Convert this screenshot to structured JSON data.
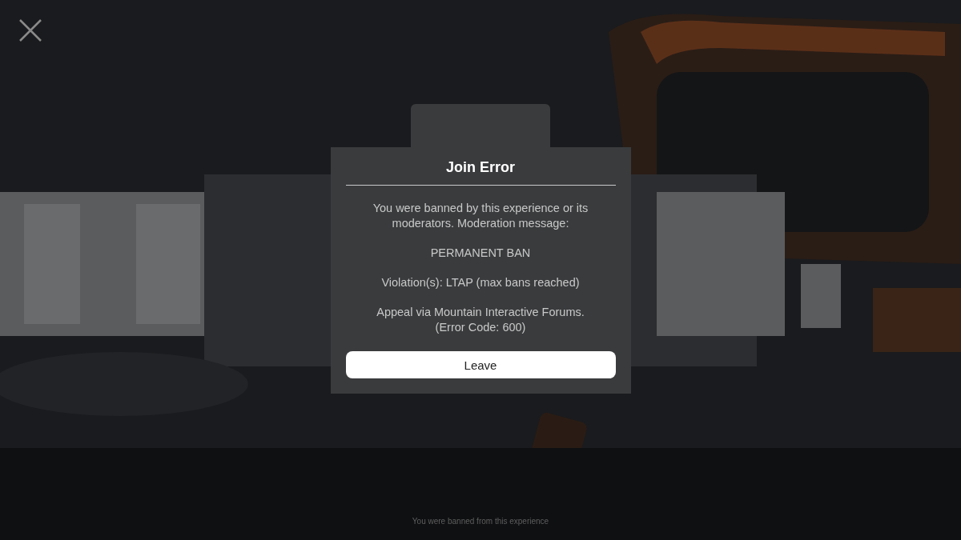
{
  "dialog": {
    "title": "Join Error",
    "paragraphs": [
      "You were banned by this experience or its\nmoderators. Moderation message:",
      "PERMANENT BAN",
      "Violation(s): LTAP (max bans reached)",
      "Appeal via Mountain Interactive Forums.\n(Error Code: 600)"
    ],
    "button": "Leave"
  },
  "status_text": "You were banned from this experience"
}
